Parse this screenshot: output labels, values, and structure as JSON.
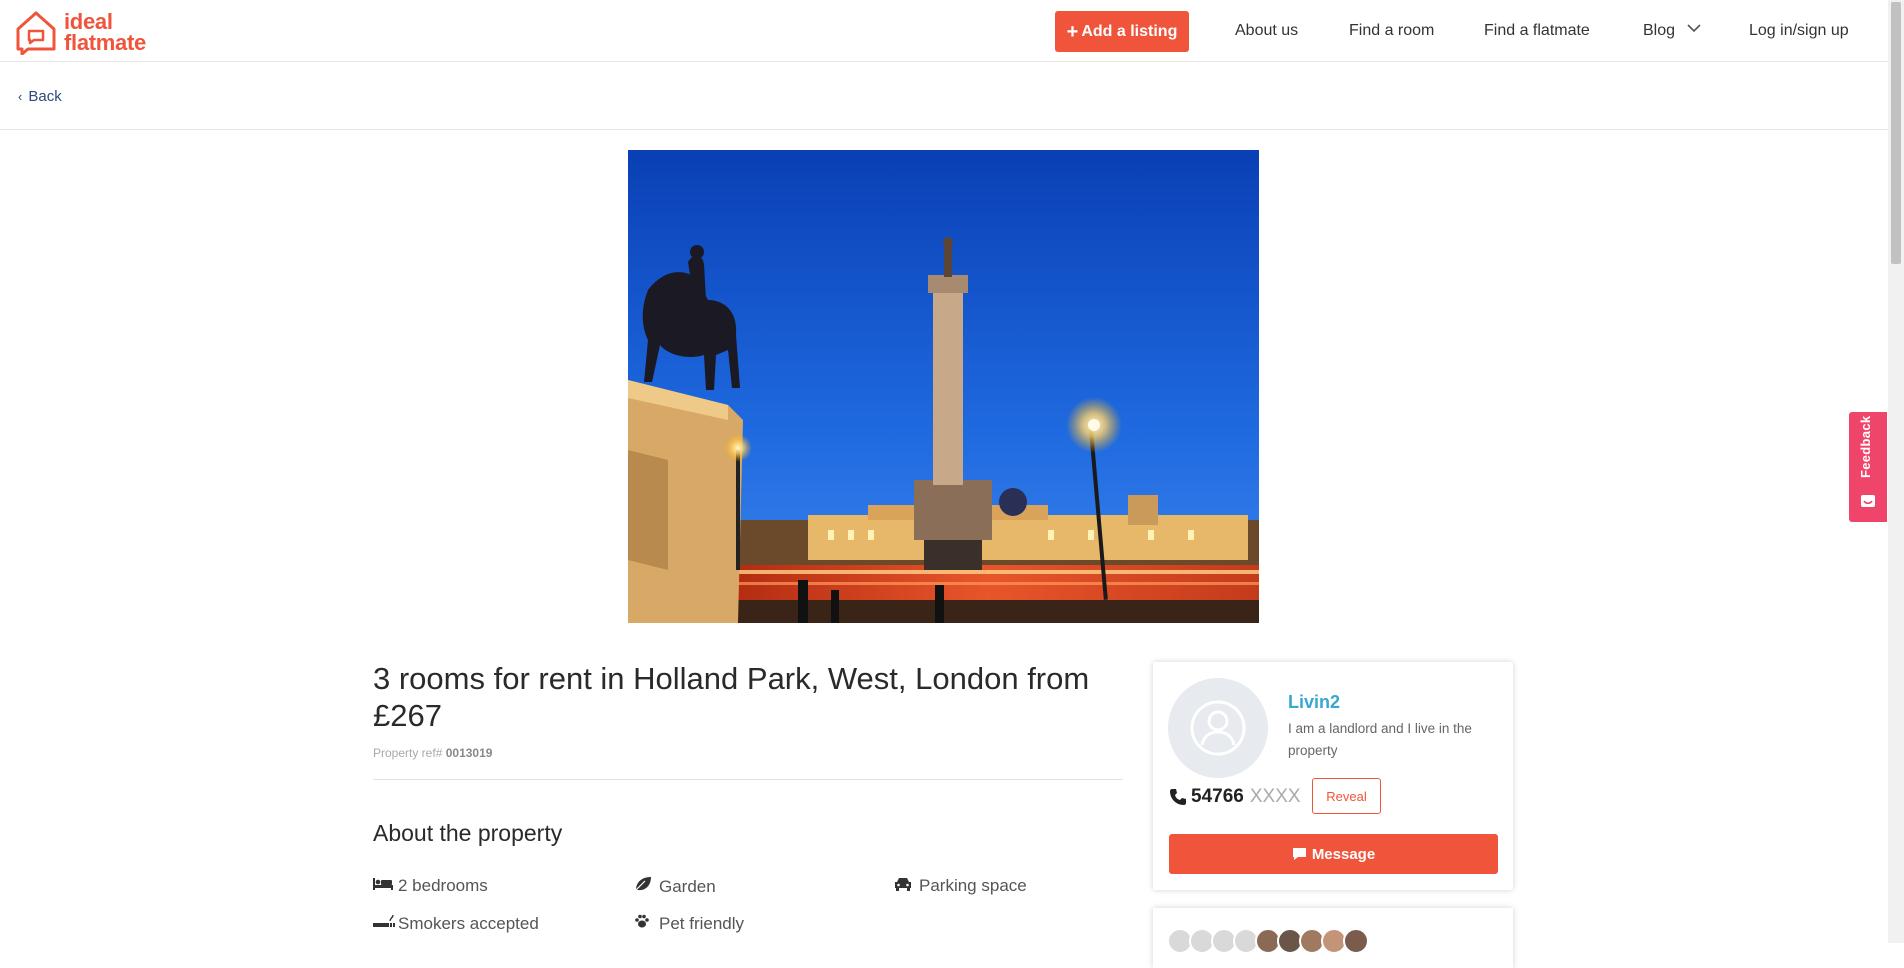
{
  "header": {
    "logo_line1": "ideal",
    "logo_line2": "flatmate",
    "add_listing": "Add a listing",
    "nav": {
      "about": "About us",
      "find_room": "Find a room",
      "find_flatmate": "Find a flatmate",
      "blog": "Blog",
      "login": "Log in/sign up"
    }
  },
  "subbar": {
    "back": "Back"
  },
  "listing": {
    "title": "3 rooms for rent in Holland Park, West, London from £267",
    "ref_label": "Property ref#",
    "ref_value": "0013019",
    "about_heading": "About the property",
    "features": [
      {
        "icon": "bed-icon",
        "label": "2 bedrooms"
      },
      {
        "icon": "leaf-icon",
        "label": "Garden"
      },
      {
        "icon": "car-icon",
        "label": "Parking space"
      },
      {
        "icon": "smoking-icon",
        "label": "Smokers accepted"
      },
      {
        "icon": "paw-icon",
        "label": "Pet friendly"
      }
    ]
  },
  "owner": {
    "name": "Livin2",
    "description": "I am a landlord and I live in the property",
    "phone_visible": "54766",
    "phone_mask": "XXXX",
    "reveal": "Reveal",
    "message": "Message"
  },
  "feedback": {
    "label": "Feedback"
  },
  "colors": {
    "accent": "#f0553b",
    "link": "#39a7d1",
    "feedback": "#f0456a"
  }
}
